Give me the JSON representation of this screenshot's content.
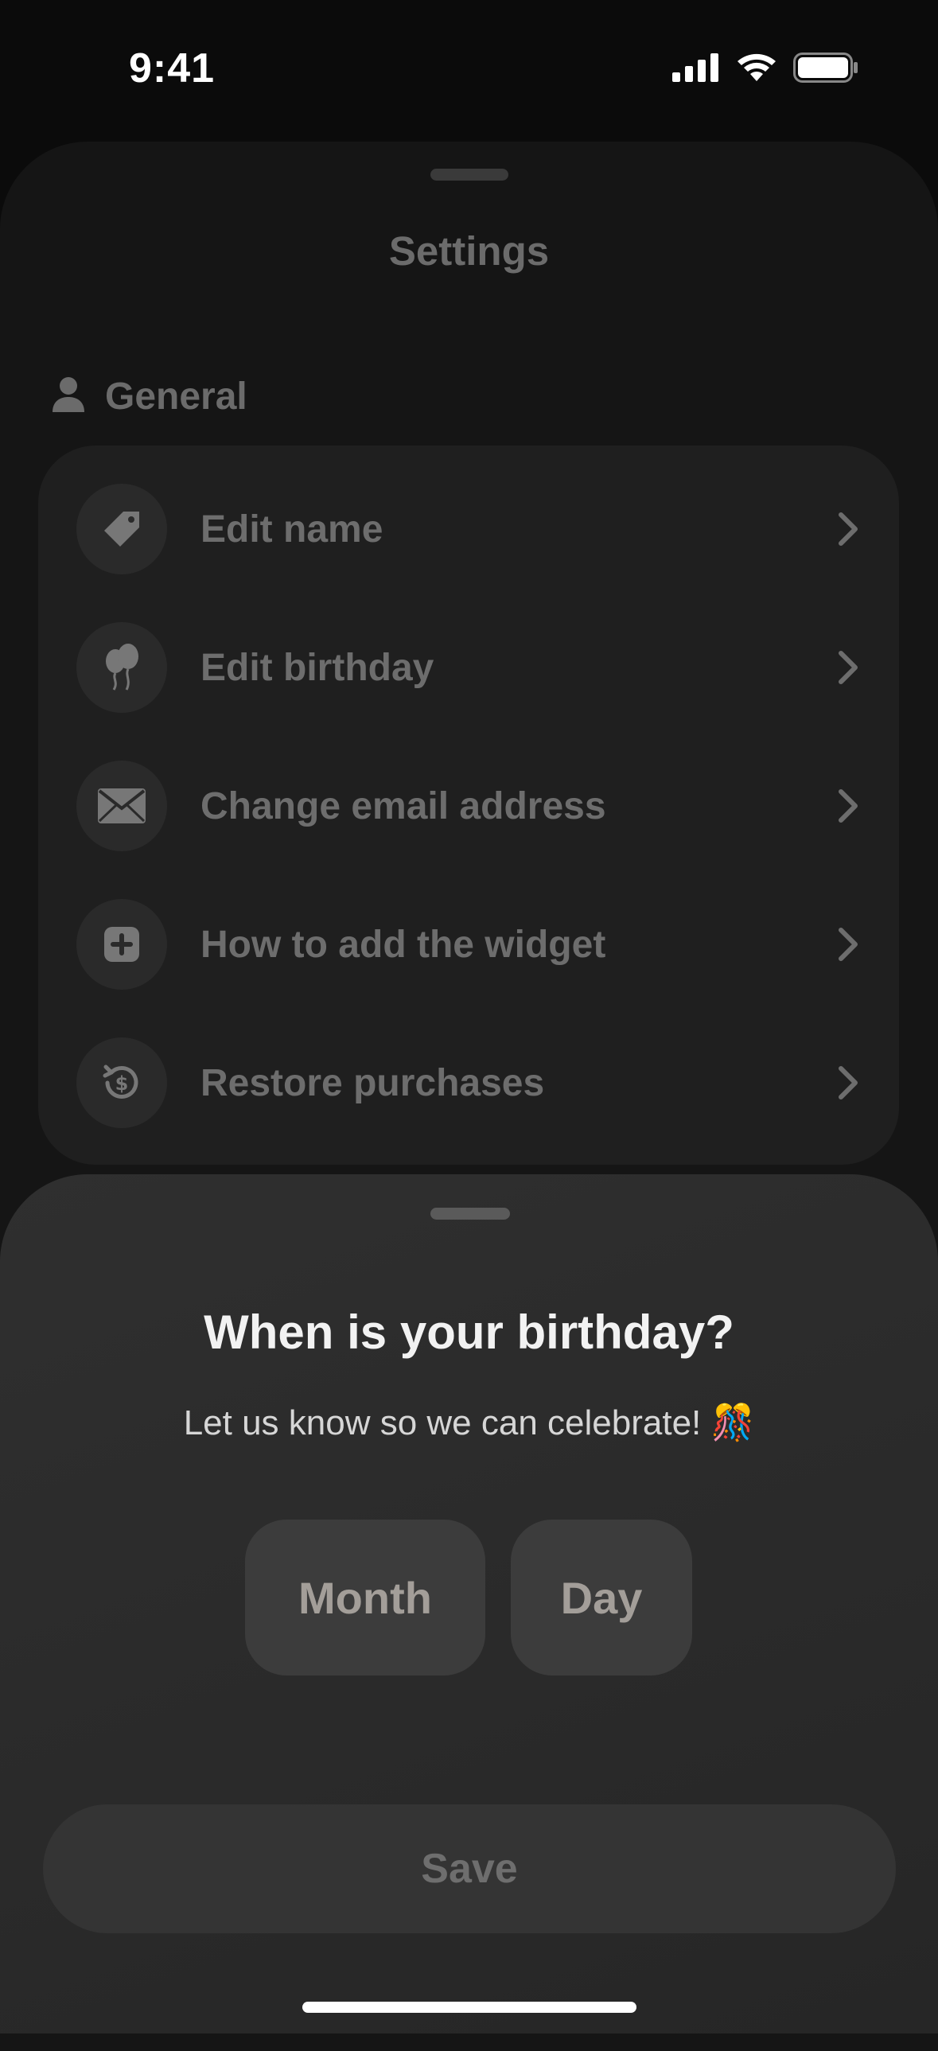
{
  "status_bar": {
    "time": "9:41",
    "icons": [
      "cellular-signal-icon",
      "wifi-icon",
      "battery-icon"
    ]
  },
  "settings": {
    "title": "Settings",
    "section": {
      "icon": "person-icon",
      "label": "General"
    },
    "items": [
      {
        "label": "Edit name",
        "icon": "tag-icon"
      },
      {
        "label": "Edit birthday",
        "icon": "balloon-icon"
      },
      {
        "label": "Change email address",
        "icon": "envelope-icon"
      },
      {
        "label": "How to add the widget",
        "icon": "plus-square-icon"
      },
      {
        "label": "Restore purchases",
        "icon": "restore-dollar-icon"
      }
    ]
  },
  "birthday_sheet": {
    "title": "When is your birthday?",
    "subtitle": "Let us know so we can celebrate! 🎊",
    "month_label": "Month",
    "day_label": "Day",
    "save_label": "Save"
  },
  "colors": {
    "background": "#0b0b0b",
    "card": "#1f1f1f",
    "sheet": "#2b2b2b",
    "muted_text": "#6d6d6d"
  }
}
